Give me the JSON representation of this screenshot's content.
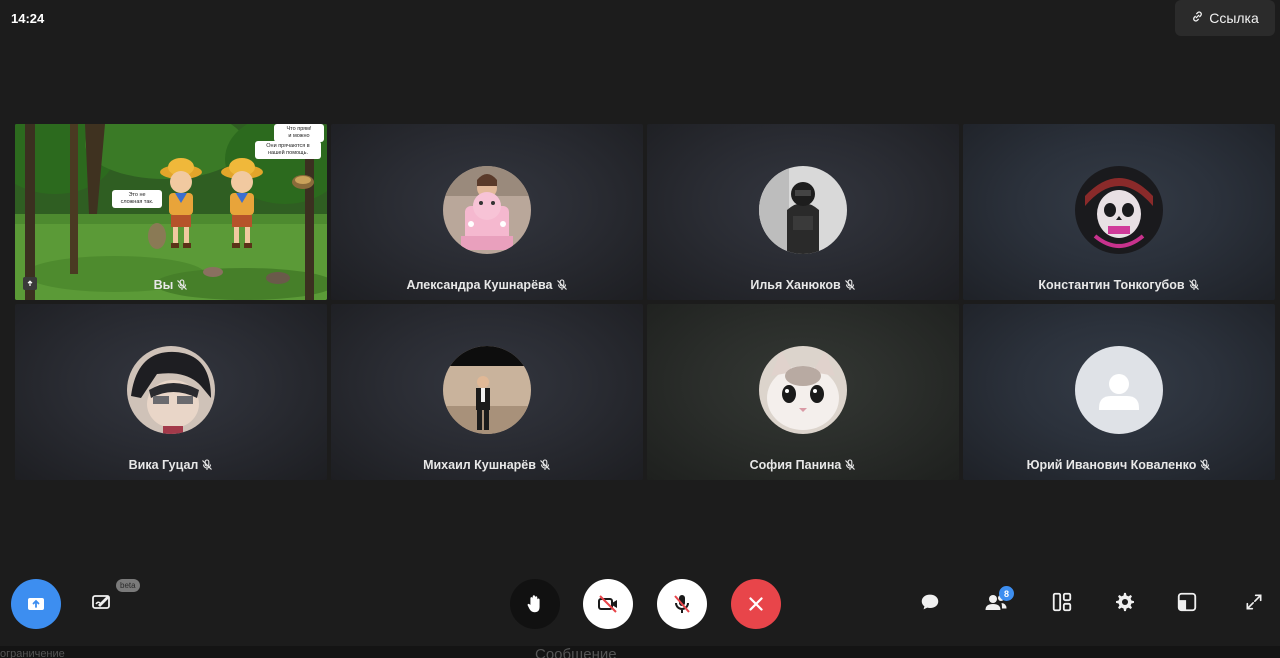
{
  "status": {
    "time": "14:24"
  },
  "header": {
    "link_label": "Ссылка"
  },
  "self_tile": {
    "label": "Вы",
    "bubbles": [
      "Это не",
      "сложная так.",
      "Что прям!",
      "и можно",
      "Они прячаются в",
      "нашей помощь."
    ]
  },
  "participants": [
    {
      "name": "Александра Кушнарёва",
      "avatar": "cake-photo"
    },
    {
      "name": "Илья Ханюков",
      "avatar": "soldier-photo"
    },
    {
      "name": "Константин Тонкогубов",
      "avatar": "skull-art"
    },
    {
      "name": "Вика Гуцал",
      "avatar": "anime-art"
    },
    {
      "name": "Михаил Кушнарёв",
      "avatar": "boy-photo"
    },
    {
      "name": "София Панина",
      "avatar": "cat-photo"
    },
    {
      "name": "Юрий Иванович Коваленко",
      "avatar": "default-user"
    }
  ],
  "controls": {
    "beta_label": "beta",
    "participants_count": "8",
    "colors": {
      "share": "#3d8ef0",
      "end_call": "#e8454a",
      "toggle_bg": "#ffffff",
      "hand_bg": "#2b2b2b"
    }
  },
  "underlay": {
    "left_text": "ограничение",
    "mid_text": "Сообщение"
  }
}
